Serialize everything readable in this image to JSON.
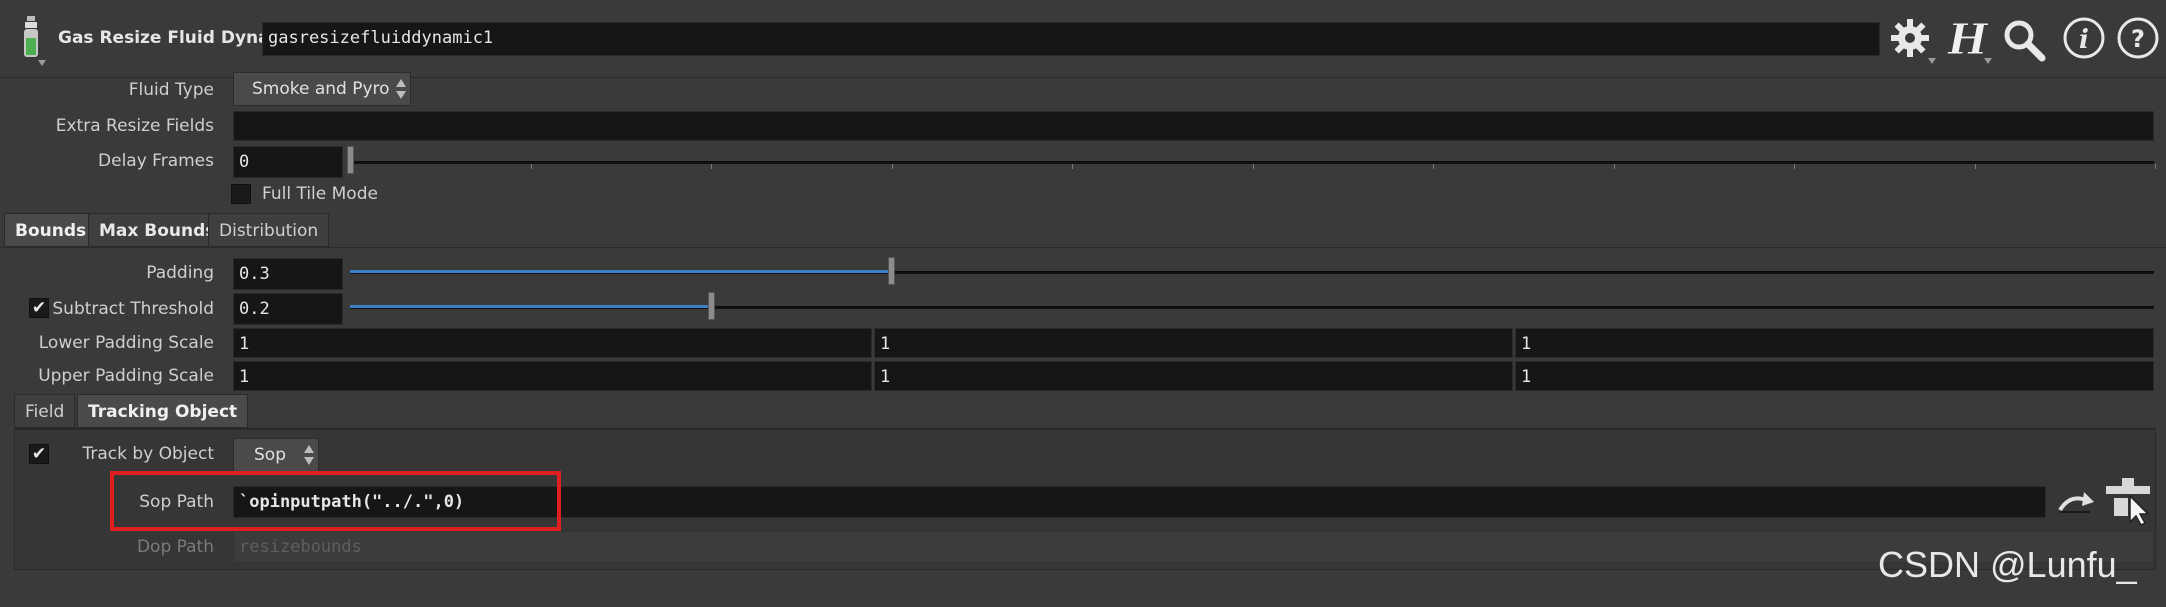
{
  "header": {
    "node_type_label": "Gas Resize Fluid Dynamic",
    "node_name": "gasresizefluiddynamic1",
    "icons": [
      "gear-icon",
      "houdini-help-icon",
      "search-icon",
      "info-icon",
      "question-icon"
    ]
  },
  "params": {
    "fluid_type": {
      "label": "Fluid Type",
      "value": "Smoke and Pyro"
    },
    "extra_resize_fields": {
      "label": "Extra Resize Fields",
      "value": ""
    },
    "delay_frames": {
      "label": "Delay Frames",
      "value": "0",
      "slider_fraction": 0.0
    },
    "full_tile_mode": {
      "label": "Full Tile Mode",
      "checked": false
    }
  },
  "tabs_main": [
    {
      "label": "Bounds",
      "active": true
    },
    {
      "label": "Max Bounds",
      "active": false
    },
    {
      "label": "Distribution",
      "active": false
    }
  ],
  "bounds": {
    "padding": {
      "label": "Padding",
      "value": "0.3",
      "slider_fraction": 0.3
    },
    "subtract_threshold": {
      "label": "Subtract Threshold",
      "value": "0.2",
      "checked": true,
      "slider_fraction": 0.2
    },
    "lower_padding_scale": {
      "label": "Lower Padding Scale",
      "values": [
        "1",
        "1",
        "1"
      ]
    },
    "upper_padding_scale": {
      "label": "Upper Padding Scale",
      "values": [
        "1",
        "1",
        "1"
      ]
    }
  },
  "tabs_sub": [
    {
      "label": "Field",
      "active": false
    },
    {
      "label": "Tracking Object",
      "active": true
    }
  ],
  "tracking": {
    "track_by_object": {
      "label": "Track by Object",
      "value": "Sop",
      "checked": true
    },
    "sop_path": {
      "label": "Sop Path",
      "value": "`opinputpath(\"../.\",0)"
    },
    "dop_path": {
      "label": "Dop Path",
      "placeholder": "resizebounds"
    }
  },
  "watermark": "CSDN @Lunfu_",
  "colors": {
    "highlight_box": "#e02020",
    "slider_fill": "#3c7fc4"
  }
}
